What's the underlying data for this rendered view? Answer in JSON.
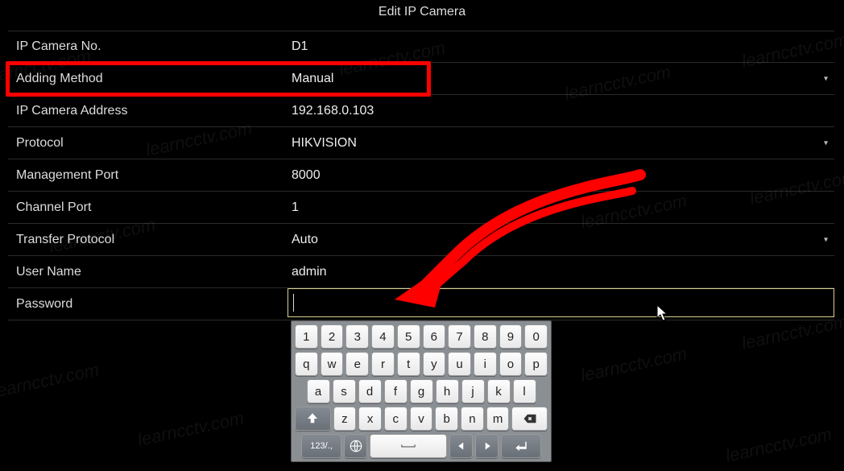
{
  "title": "Edit IP Camera",
  "fields": {
    "camera_no": {
      "label": "IP Camera No.",
      "value": "D1",
      "dropdown": false
    },
    "adding_method": {
      "label": "Adding Method",
      "value": "Manual",
      "dropdown": true
    },
    "ip_address": {
      "label": "IP Camera Address",
      "value": "192.168.0.103",
      "dropdown": false
    },
    "protocol": {
      "label": "Protocol",
      "value": "HIKVISION",
      "dropdown": true
    },
    "mgmt_port": {
      "label": "Management Port",
      "value": "8000",
      "dropdown": false
    },
    "channel_port": {
      "label": "Channel Port",
      "value": "1",
      "dropdown": false
    },
    "transfer_proto": {
      "label": "Transfer Protocol",
      "value": "Auto",
      "dropdown": true
    },
    "user_name": {
      "label": "User Name",
      "value": "admin",
      "dropdown": false
    },
    "password": {
      "label": "Password",
      "value": "",
      "dropdown": false
    }
  },
  "keyboard": {
    "row1": [
      "1",
      "2",
      "3",
      "4",
      "5",
      "6",
      "7",
      "8",
      "9",
      "0"
    ],
    "row2": [
      "q",
      "w",
      "e",
      "r",
      "t",
      "y",
      "u",
      "i",
      "o",
      "p"
    ],
    "row3": [
      "a",
      "s",
      "d",
      "f",
      "g",
      "h",
      "j",
      "k",
      "l"
    ],
    "row4_shift": "⇧",
    "row4": [
      "z",
      "x",
      "c",
      "v",
      "b",
      "n",
      "m"
    ],
    "row4_backspace": "⌫",
    "row5_symbols": "123/.,",
    "row5_globe": "globe",
    "row5_space": " ",
    "row5_left": "◀",
    "row5_right": "▶",
    "row5_enter": "↵"
  },
  "watermark_text": "learncctv.com",
  "annotations": {
    "highlight": "ip_address",
    "arrow_target": "password"
  }
}
